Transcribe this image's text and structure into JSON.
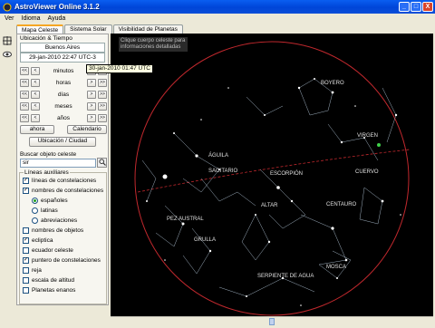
{
  "window": {
    "title": "AstroViewer Online 3.1.2",
    "minimize": "_",
    "maximize": "□",
    "close": "X"
  },
  "menu": [
    "Ver",
    "Idioma",
    "Ayuda"
  ],
  "tabs": [
    "Mapa Celeste",
    "Sistema Solar",
    "Visibilidad de Planetas"
  ],
  "location_time": {
    "title": "Ubicación & Tiempo",
    "city": "Buenos Aires",
    "datetime": "29-jan-2010 22:47 UTC-3"
  },
  "steppers": [
    {
      "label": "minutos"
    },
    {
      "label": "horas"
    },
    {
      "label": "días"
    },
    {
      "label": "meses"
    },
    {
      "label": "años"
    }
  ],
  "stepper_glyphs": {
    "fast_back": "<<",
    "back": "<",
    "fwd": ">",
    "fast_fwd": ">>"
  },
  "buttons": {
    "now": "ahora",
    "calendar": "Calendario",
    "location_city": "Ubicación / Ciudad"
  },
  "search": {
    "label": "Buscar objeto celeste",
    "value": "sir"
  },
  "aux_lines": {
    "title": "Líneas auxiliares",
    "options": [
      {
        "label": "líneas de constelaciones",
        "checked": true
      },
      {
        "label": "nombres de constelaciones",
        "checked": true
      },
      {
        "label": "españoles",
        "radio": true,
        "selected": true
      },
      {
        "label": "latinas",
        "radio": true,
        "selected": false
      },
      {
        "label": "abreviaciones",
        "radio": true,
        "selected": false
      },
      {
        "label": "nombres de objetos",
        "checked": false
      },
      {
        "label": "ecliptica",
        "checked": true
      },
      {
        "label": "ecuador celeste",
        "checked": false
      },
      {
        "label": "puntero de constelaciones",
        "checked": true
      },
      {
        "label": "reja",
        "checked": false
      },
      {
        "label": "escala de altitud",
        "checked": false
      },
      {
        "label": "Planetas enanos",
        "checked": false
      }
    ]
  },
  "sky": {
    "hint": "Clique cuerpo celeste para informaciones detalladas",
    "tooltip": "30-jan-2010 01:47 UTC",
    "horizon_color": "#c0282d",
    "ecliptic_color": "#c0282d",
    "constellations": [
      {
        "name": "BOYERO"
      },
      {
        "name": "ÁGUILA"
      },
      {
        "name": "VIRGEN"
      },
      {
        "name": "SAGITARIO"
      },
      {
        "name": "ESCORPIÓN"
      },
      {
        "name": "CUERVO"
      },
      {
        "name": "ALTAR"
      },
      {
        "name": "CENTAURO"
      },
      {
        "name": "PEZ AUSTRAL"
      },
      {
        "name": "GRULLA"
      },
      {
        "name": "MOSCA"
      },
      {
        "name": "SERPIENTE DE AGUA"
      }
    ]
  },
  "icons": {
    "crosshair": "crosshair-icon",
    "eye": "eye-icon",
    "search": "magnifier-icon",
    "app": "app-logo-icon"
  }
}
